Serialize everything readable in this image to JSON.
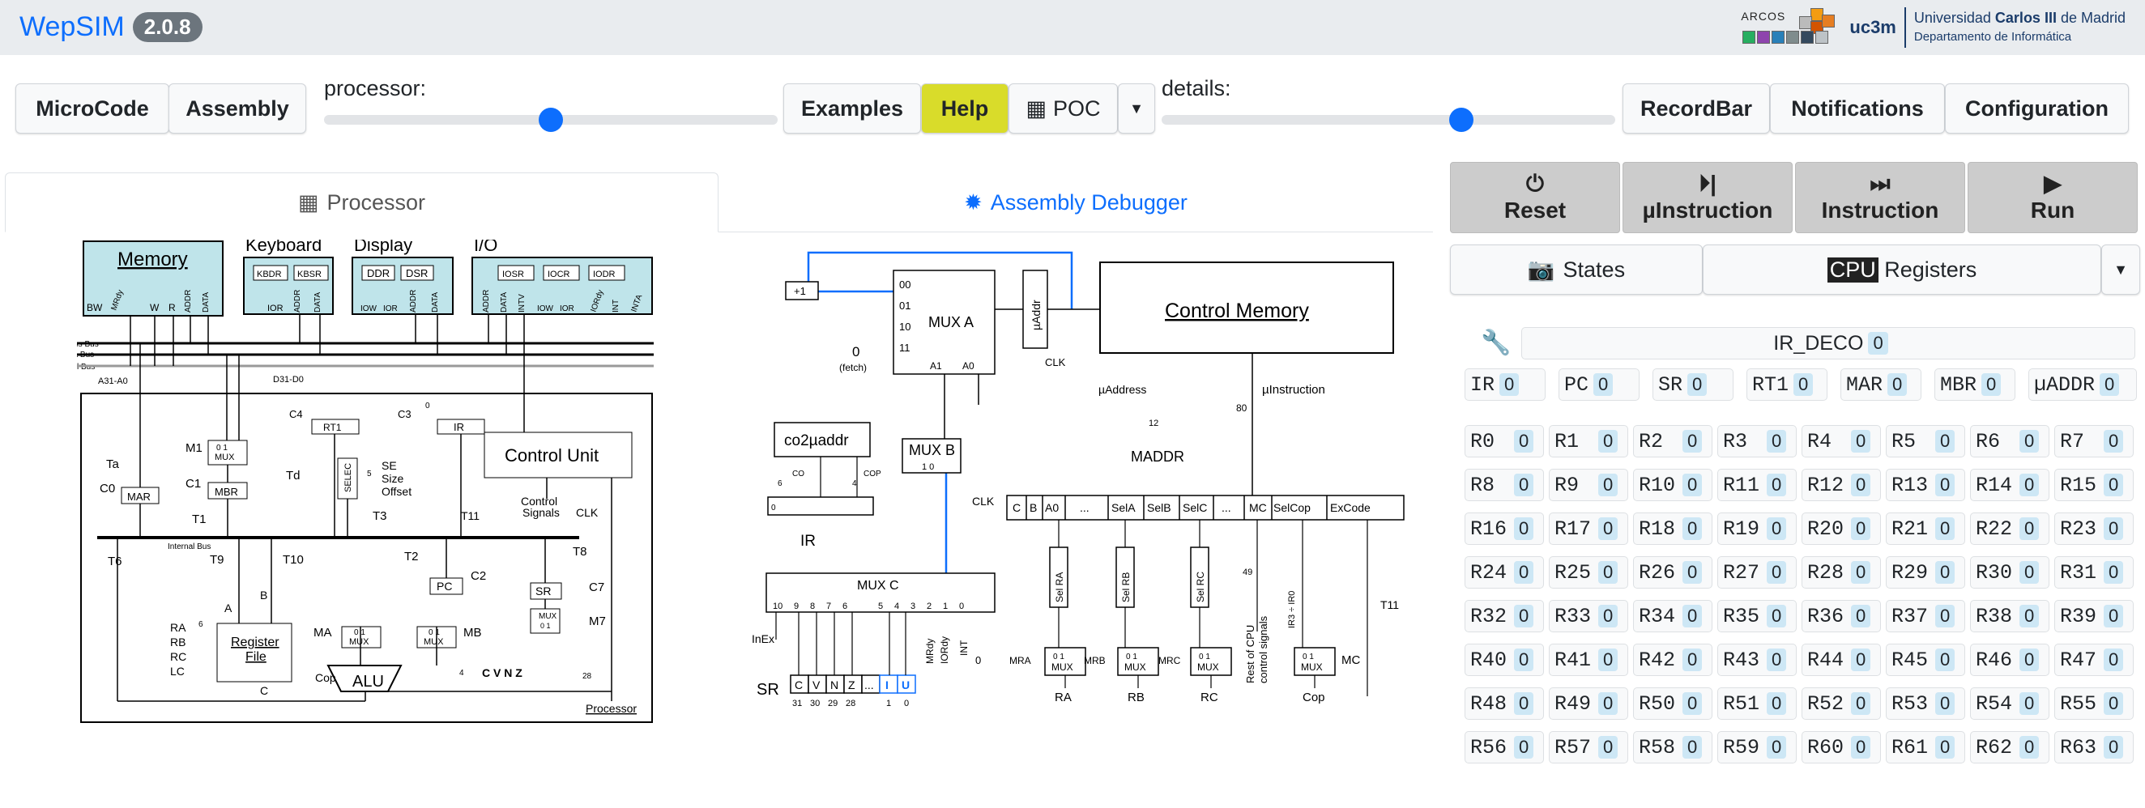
{
  "app": {
    "name": "WepSIM",
    "version": "2.0.8"
  },
  "logos": {
    "arcos": "ARCOS",
    "uc3m": "uc3m",
    "university": [
      "Universidad ",
      "Carlos III",
      " de Madrid"
    ],
    "department": "Departamento de Informática"
  },
  "toolbar": {
    "microcode": "MicroCode",
    "assembly": "Assembly",
    "processor_label": "processor:",
    "processor_level": 0.5,
    "examples": "Examples",
    "help": "Help",
    "poc": "POC",
    "details_label": "details:",
    "details_level": 0.66,
    "recordbar": "RecordBar",
    "notifications": "Notifications",
    "configuration": "Configuration"
  },
  "tabs": {
    "processor": "Processor",
    "debugger": "Assembly Debugger"
  },
  "execution": {
    "reset": "Reset",
    "uinstruction": "µInstruction",
    "instruction": "Instruction",
    "run": "Run"
  },
  "views": {
    "states": "States",
    "cpu": "CPU",
    "registers": " Registers"
  },
  "ir_deco": {
    "label": "IR_DECO",
    "value": "0"
  },
  "special_registers": [
    {
      "name": "IR",
      "value": "0"
    },
    {
      "name": "PC",
      "value": "0"
    },
    {
      "name": "SR",
      "value": "0"
    },
    {
      "name": "RT1",
      "value": "0"
    },
    {
      "name": "MAR",
      "value": "0"
    },
    {
      "name": "MBR",
      "value": "0"
    },
    {
      "name": "µADDR",
      "value": "0"
    }
  ],
  "registers": [
    {
      "name": "R0",
      "value": "0"
    },
    {
      "name": "R1",
      "value": "0"
    },
    {
      "name": "R2",
      "value": "0"
    },
    {
      "name": "R3",
      "value": "0"
    },
    {
      "name": "R4",
      "value": "0"
    },
    {
      "name": "R5",
      "value": "0"
    },
    {
      "name": "R6",
      "value": "0"
    },
    {
      "name": "R7",
      "value": "0"
    },
    {
      "name": "R8",
      "value": "0"
    },
    {
      "name": "R9",
      "value": "0"
    },
    {
      "name": "R10",
      "value": "0"
    },
    {
      "name": "R11",
      "value": "0"
    },
    {
      "name": "R12",
      "value": "0"
    },
    {
      "name": "R13",
      "value": "0"
    },
    {
      "name": "R14",
      "value": "0"
    },
    {
      "name": "R15",
      "value": "0"
    },
    {
      "name": "R16",
      "value": "0"
    },
    {
      "name": "R17",
      "value": "0"
    },
    {
      "name": "R18",
      "value": "0"
    },
    {
      "name": "R19",
      "value": "0"
    },
    {
      "name": "R20",
      "value": "0"
    },
    {
      "name": "R21",
      "value": "0"
    },
    {
      "name": "R22",
      "value": "0"
    },
    {
      "name": "R23",
      "value": "0"
    },
    {
      "name": "R24",
      "value": "0"
    },
    {
      "name": "R25",
      "value": "0"
    },
    {
      "name": "R26",
      "value": "0"
    },
    {
      "name": "R27",
      "value": "0"
    },
    {
      "name": "R28",
      "value": "0"
    },
    {
      "name": "R29",
      "value": "0"
    },
    {
      "name": "R30",
      "value": "0"
    },
    {
      "name": "R31",
      "value": "0"
    },
    {
      "name": "R32",
      "value": "0"
    },
    {
      "name": "R33",
      "value": "0"
    },
    {
      "name": "R34",
      "value": "0"
    },
    {
      "name": "R35",
      "value": "0"
    },
    {
      "name": "R36",
      "value": "0"
    },
    {
      "name": "R37",
      "value": "0"
    },
    {
      "name": "R38",
      "value": "0"
    },
    {
      "name": "R39",
      "value": "0"
    },
    {
      "name": "R40",
      "value": "0"
    },
    {
      "name": "R41",
      "value": "0"
    },
    {
      "name": "R42",
      "value": "0"
    },
    {
      "name": "R43",
      "value": "0"
    },
    {
      "name": "R44",
      "value": "0"
    },
    {
      "name": "R45",
      "value": "0"
    },
    {
      "name": "R46",
      "value": "0"
    },
    {
      "name": "R47",
      "value": "0"
    },
    {
      "name": "R48",
      "value": "0"
    },
    {
      "name": "R49",
      "value": "0"
    },
    {
      "name": "R50",
      "value": "0"
    },
    {
      "name": "R51",
      "value": "0"
    },
    {
      "name": "R52",
      "value": "0"
    },
    {
      "name": "R53",
      "value": "0"
    },
    {
      "name": "R54",
      "value": "0"
    },
    {
      "name": "R55",
      "value": "0"
    },
    {
      "name": "R56",
      "value": "0"
    },
    {
      "name": "R57",
      "value": "0"
    },
    {
      "name": "R58",
      "value": "0"
    },
    {
      "name": "R59",
      "value": "0"
    },
    {
      "name": "R60",
      "value": "0"
    },
    {
      "name": "R61",
      "value": "0"
    },
    {
      "name": "R62",
      "value": "0"
    },
    {
      "name": "R63",
      "value": "0"
    }
  ],
  "processor_diagram": {
    "memory": "Memory",
    "memory_pins": [
      "BW",
      "MRdy",
      "W",
      "R",
      "ADDR",
      "DATA"
    ],
    "keyboard": "Keyboard",
    "kbdr": "KBDR",
    "kbsr": "KBSR",
    "kb_pins": [
      "IOR",
      "ADDR",
      "DATA"
    ],
    "display": "Display",
    "ddr": "DDR",
    "dsr": "DSR",
    "disp_pins": [
      "IOW",
      "IOR",
      "ADDR",
      "DATA"
    ],
    "io": "I/O",
    "iosr": "IOSR",
    "iocr": "IOCR",
    "iodr": "IODR",
    "io_pins": [
      "ADDR",
      "DATA",
      "INTV",
      "IOW",
      "IOR",
      "IORdy",
      "INT",
      "INTA"
    ],
    "address_bus": "Address Bus",
    "data_bus": "Data Bus",
    "control_bus": "Control Bus",
    "a31": "A31-A0",
    "d31": "D31-D0",
    "c4": "C4",
    "rt1": "RT1",
    "c3": "C3",
    "zero": "0",
    "ir": "IR",
    "control_unit": "Control Unit",
    "se": "SE",
    "size": "Size",
    "offset": "Offset",
    "selec": "SELEC",
    "five": "5",
    "t3": "T3",
    "control_signals": [
      "Control",
      "Signals"
    ],
    "clk": "CLK",
    "t11": "T11",
    "ta": "Ta",
    "m1": "M1",
    "mux": "MUX",
    "mux_in": "0 1",
    "td": "Td",
    "c1": "C1",
    "mbr": "MBR",
    "c0": "C0",
    "mar": "MAR",
    "t1": "T1",
    "internal_bus": "Internal Bus",
    "t6": "T6",
    "t9": "T9",
    "t10": "T10",
    "t2": "T2",
    "t8": "T8",
    "pc": "PC",
    "c2": "C2",
    "sr": "SR",
    "c7": "C7",
    "m7": "M7",
    "a": "A",
    "b": "B",
    "ra": "RA",
    "rb": "RB",
    "rc": "RC",
    "lc": "LC",
    "six": "6",
    "register_file": [
      "Register",
      "File"
    ],
    "ma": "MA",
    "mb": "MB",
    "alu": "ALU",
    "cop": "Cop",
    "cvnz": "C V N Z",
    "four": "4",
    "c": "C",
    "twenty_eight": "28",
    "caption": "Processor"
  },
  "debugger_diagram": {
    "plus1": "+1",
    "muxa": "MUX A",
    "muxa_in": [
      "00",
      "01",
      "10",
      "11"
    ],
    "a1": "A1",
    "a0": "A0",
    "zero_fetch": [
      "0",
      "(fetch)"
    ],
    "uaddr": "µAddr",
    "clk": "CLK",
    "control_memory": "Control Memory",
    "uaddress": "µAddress",
    "uinstruction": "µInstruction",
    "twelve": "12",
    "eighty": "80",
    "maddr": "MADDR",
    "co2uaddr": "co2µaddr",
    "co": "CO",
    "cop": "COP",
    "six": "6",
    "four": "4",
    "ir_reg_zero": "0",
    "ir": "IR",
    "muxb": "MUX B",
    "muxb_in": "1 0",
    "ctrl_fields": [
      "C",
      "B",
      "A0",
      "...",
      "SelA",
      "SelB",
      "SelC",
      "...",
      "MC",
      "SelCop",
      "ExCode"
    ],
    "muxc": "MUX C",
    "muxc_in": [
      "10",
      "9",
      "8",
      "7",
      "6",
      "5",
      "4",
      "3",
      "2",
      "1",
      "0"
    ],
    "sel_ra": "Sel RA",
    "sel_rb": "Sel RB",
    "sel_rc": "Sel RC",
    "mux": "MUX",
    "mux_in": "0 1",
    "mra": "MRA",
    "mrb": "MRB",
    "mrc": "MRC",
    "ra": "RA",
    "rb": "RB",
    "rc": "RC",
    "forty_nine": "49",
    "rest": [
      "Rest of CPU",
      "control signals"
    ],
    "ir3": "IR3 ÷ IR0",
    "mc": "MC",
    "cop_out": "Cop",
    "t11": "T11",
    "inex": "InEx",
    "mrdy": "MRdy",
    "iordy": "IORdy",
    "int": "INT",
    "zero_in": "0",
    "sr": "SR",
    "sr_bits": [
      "C",
      "V",
      "N",
      "Z",
      "...",
      "I",
      "U"
    ],
    "sr_nums": [
      "31",
      "30",
      "29",
      "28",
      "1",
      "0"
    ]
  }
}
